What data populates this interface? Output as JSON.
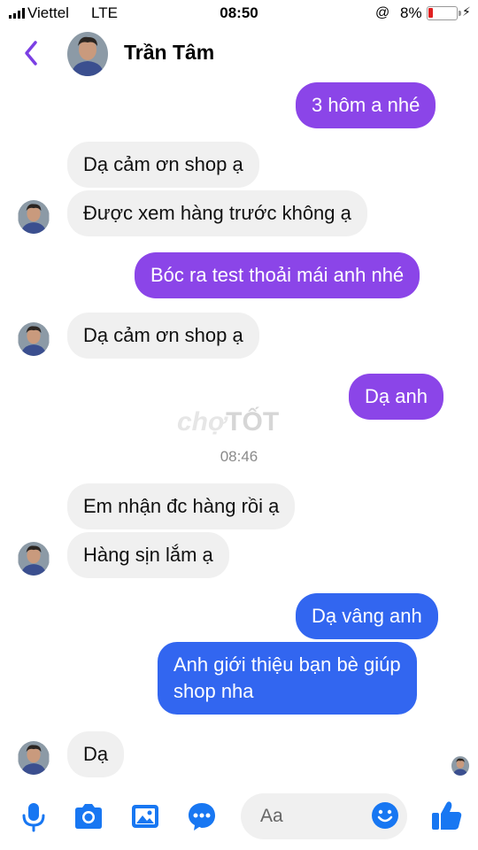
{
  "status_bar": {
    "carrier": "Viettel",
    "network": "LTE",
    "time": "08:50",
    "lock_icon": "@",
    "battery_percent": "8%",
    "battery_level": 0.08,
    "battery_color": "#e02020"
  },
  "header": {
    "contact_name": "Trần Tâm",
    "back_icon": "chevron-left-icon"
  },
  "messages": [
    {
      "side": "out",
      "text": "3 hôm a nhé"
    },
    {
      "side": "in",
      "text": "Dạ cảm ơn shop ạ"
    },
    {
      "side": "in",
      "text": "Được xem hàng trước không ạ"
    },
    {
      "side": "out",
      "text": "Bóc ra test thoải mái anh nhé"
    },
    {
      "side": "in",
      "text": "Dạ cảm ơn shop ạ"
    },
    {
      "side": "out",
      "text": "Dạ anh"
    },
    {
      "side": "in",
      "text": "Em nhận đc hàng rồi ạ"
    },
    {
      "side": "in",
      "text": "Hàng sịn lắm ạ"
    },
    {
      "side": "out",
      "text": "Dạ vâng anh"
    },
    {
      "side": "out",
      "lines": [
        "Anh giới thiệu bạn bè giúp",
        "shop nha"
      ]
    },
    {
      "side": "in",
      "text": "Dạ"
    }
  ],
  "timestamp": "08:46",
  "watermark": {
    "part1": "chợ",
    "part2": "TỐT"
  },
  "composer": {
    "placeholder": "Aa",
    "icons": [
      "microphone-icon",
      "camera-icon",
      "image-icon",
      "chat-bubble-icon",
      "emoji-icon",
      "thumbs-up-icon"
    ]
  },
  "colors": {
    "accent": "#7b3fe4",
    "outgoing_purple": "#8b45e8",
    "outgoing_blue": "#3266f0",
    "incoming": "#f0f0f0",
    "icon_blue": "#1877f2"
  }
}
